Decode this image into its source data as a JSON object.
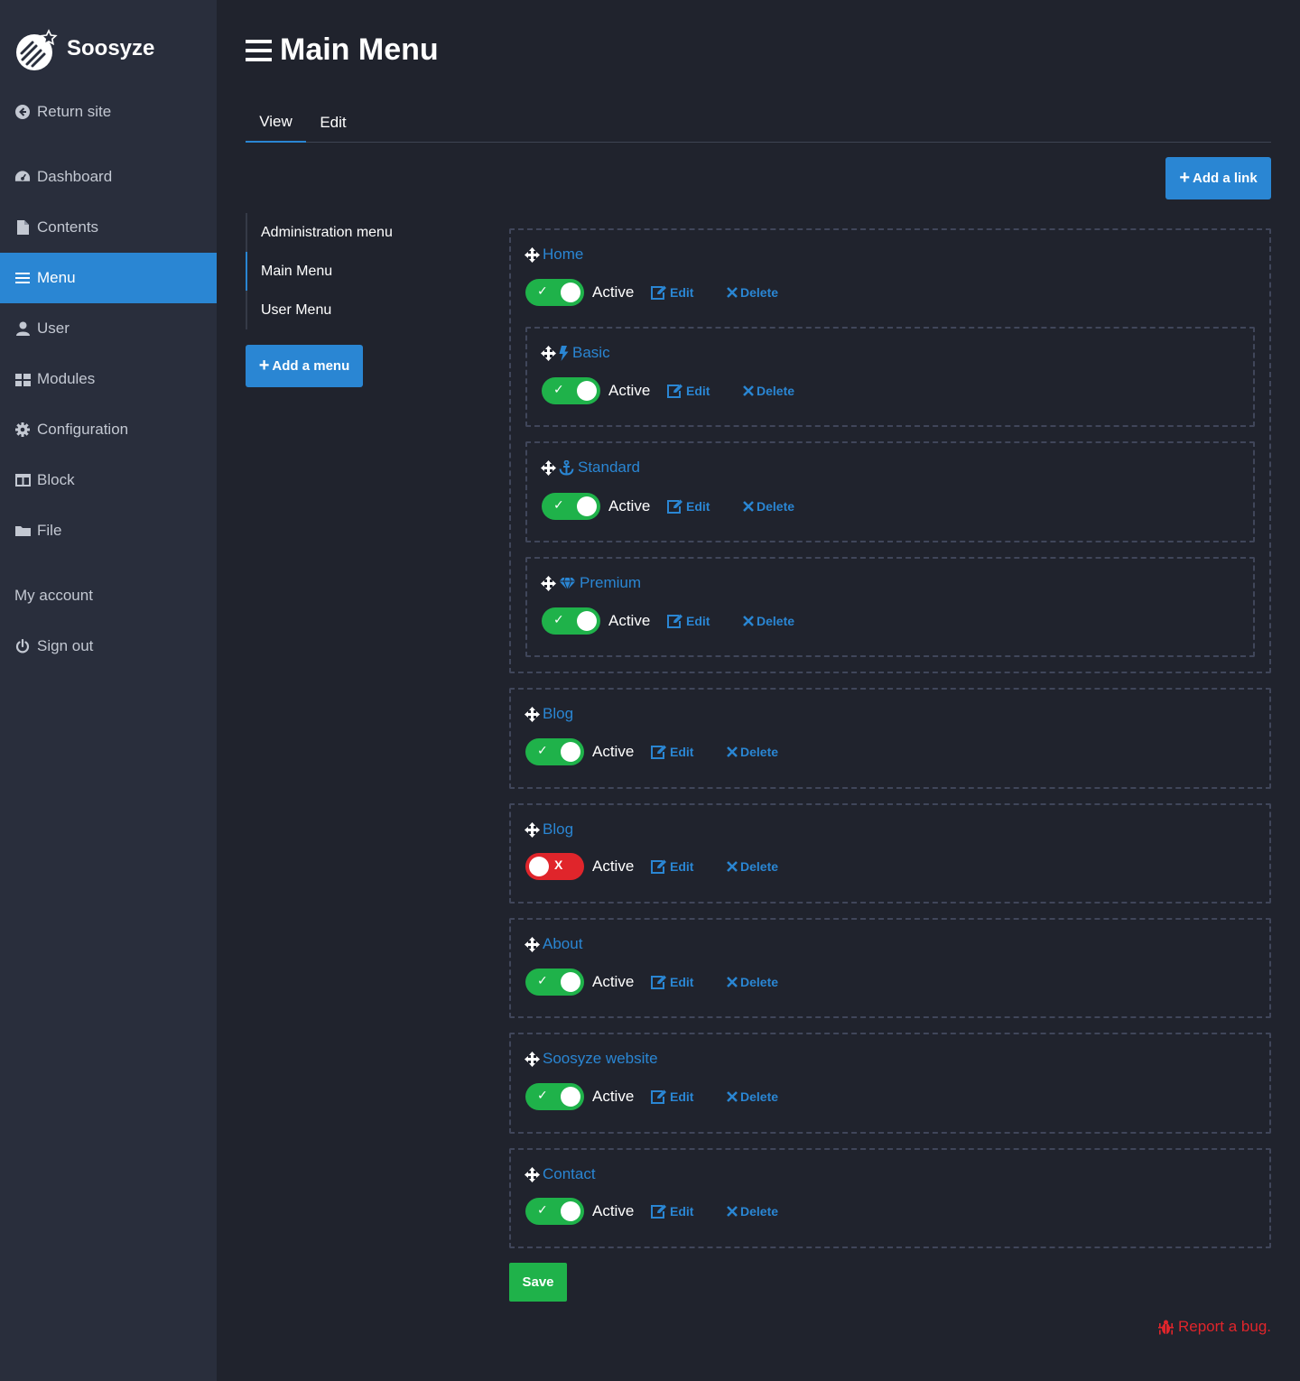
{
  "app": {
    "brand": "Soosyze"
  },
  "sidebar": {
    "return_site": "Return site",
    "items": [
      {
        "label": "Dashboard",
        "icon": "dashboard-icon"
      },
      {
        "label": "Contents",
        "icon": "file-icon"
      },
      {
        "label": "Menu",
        "icon": "bars-icon",
        "active": true
      },
      {
        "label": "User",
        "icon": "user-icon"
      },
      {
        "label": "Modules",
        "icon": "cubes-icon"
      },
      {
        "label": "Configuration",
        "icon": "gear-icon"
      },
      {
        "label": "Block",
        "icon": "columns-icon"
      },
      {
        "label": "File",
        "icon": "folder-icon"
      }
    ],
    "my_account": "My account",
    "sign_out": "Sign out"
  },
  "header": {
    "title": "Main Menu"
  },
  "tabs": [
    {
      "label": "View",
      "active": true
    },
    {
      "label": "Edit"
    }
  ],
  "buttons": {
    "add_link": "Add a link",
    "add_menu": "Add a menu",
    "save": "Save"
  },
  "menus": [
    {
      "label": "Administration menu"
    },
    {
      "label": "Main Menu",
      "active": true
    },
    {
      "label": "User Menu"
    }
  ],
  "links": [
    {
      "title": "Home",
      "active_label": "Active",
      "enabled": true,
      "edit": "Edit",
      "delete": "Delete"
    },
    {
      "title": "Basic",
      "icon": "bolt-icon",
      "active_label": "Active",
      "enabled": true,
      "edit": "Edit",
      "delete": "Delete"
    },
    {
      "title": "Standard",
      "icon": "anchor-icon",
      "active_label": "Active",
      "enabled": true,
      "edit": "Edit",
      "delete": "Delete"
    },
    {
      "title": "Premium",
      "icon": "gem-icon",
      "active_label": "Active",
      "enabled": true,
      "edit": "Edit",
      "delete": "Delete"
    },
    {
      "title": "Blog",
      "active_label": "Active",
      "enabled": true,
      "edit": "Edit",
      "delete": "Delete"
    },
    {
      "title": "Blog",
      "active_label": "Active",
      "enabled": false,
      "edit": "Edit",
      "delete": "Delete"
    },
    {
      "title": "About",
      "active_label": "Active",
      "enabled": true,
      "edit": "Edit",
      "delete": "Delete"
    },
    {
      "title": "Soosyze website",
      "active_label": "Active",
      "enabled": true,
      "edit": "Edit",
      "delete": "Delete"
    },
    {
      "title": "Contact",
      "active_label": "Active",
      "enabled": true,
      "edit": "Edit",
      "delete": "Delete"
    }
  ],
  "toggle_marks": {
    "on": "✓",
    "off": "X"
  },
  "footer": {
    "report_bug": "Report a bug."
  },
  "colors": {
    "accent": "#2a86d3",
    "success": "#1fb24a",
    "danger": "#e0252b",
    "sidebar_bg": "#292e3c",
    "page_bg": "#20232d"
  }
}
